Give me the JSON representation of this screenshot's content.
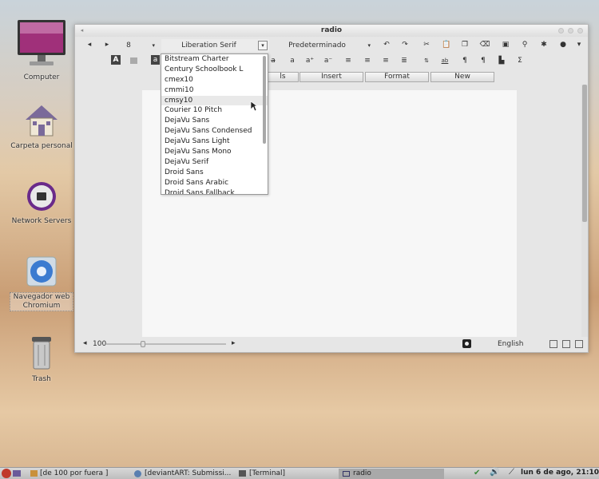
{
  "desktop": {
    "icons": [
      {
        "label": "Computer"
      },
      {
        "label": "Carpeta personal"
      },
      {
        "label": "Network Servers"
      },
      {
        "label": "Navegador web Chromium"
      },
      {
        "label": "Trash"
      }
    ]
  },
  "window": {
    "title": "radio",
    "toolbar1": {
      "font_size": "8",
      "font_name": "Liberation Serif",
      "style": "Predeterminado"
    },
    "menu_buttons": [
      "ls",
      "Insert",
      "Format",
      "New"
    ],
    "status": {
      "zoom": "100",
      "language": "English"
    }
  },
  "font_dropdown": {
    "items": [
      "Bitstream Charter",
      "Century Schoolbook L",
      "cmex10",
      "cmmi10",
      "cmsy10",
      "Courier 10 Pitch",
      "DejaVu Sans",
      "DejaVu Sans Condensed",
      "DejaVu Sans Light",
      "DejaVu Sans Mono",
      "DejaVu Serif",
      "Droid Sans",
      "Droid Sans Arabic",
      "Droid Sans Fallback"
    ],
    "highlighted": "cmsy10"
  },
  "taskbar": {
    "tasks": [
      "[de 100 por fuera ]",
      "[deviantART: Submissi...",
      "[Terminal]",
      "radio"
    ],
    "clock": "lun  6 de ago, 21:10"
  }
}
